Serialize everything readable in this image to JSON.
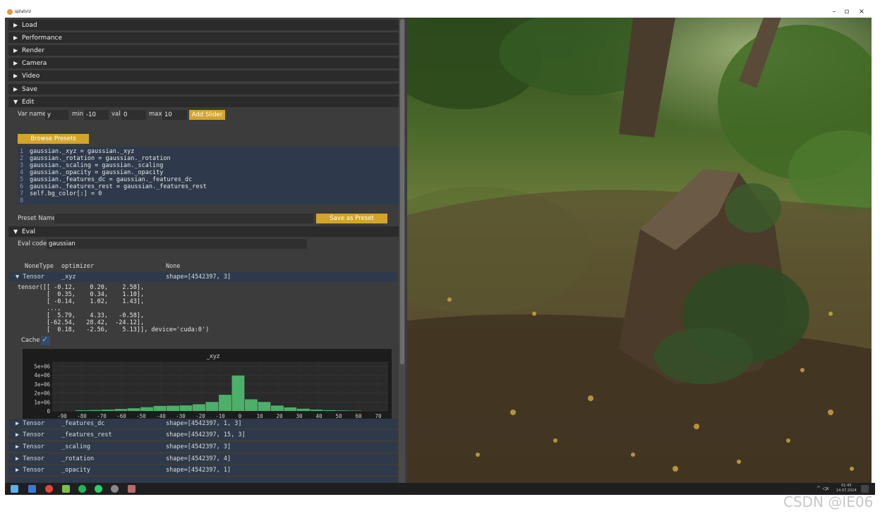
{
  "window": {
    "title": "splatviz",
    "controls": [
      "–",
      "▫",
      "×"
    ]
  },
  "sections": [
    {
      "label": "Load",
      "expanded": false
    },
    {
      "label": "Performance",
      "expanded": false
    },
    {
      "label": "Render",
      "expanded": false
    },
    {
      "label": "Camera",
      "expanded": false
    },
    {
      "label": "Video",
      "expanded": false
    },
    {
      "label": "Save",
      "expanded": false
    },
    {
      "label": "Edit",
      "expanded": true
    }
  ],
  "edit": {
    "var_name_label": "Var name",
    "var_name_value": "y",
    "min_label": "min",
    "min_value": "-10",
    "val_label": "val",
    "val_value": "0",
    "max_label": "max",
    "max_value": "10",
    "add_slider_label": "Add Slider",
    "browse_presets_label": "Browse Presets",
    "code_lines": [
      {
        "n": "1",
        "text": "gaussian._xyz = gaussian._xyz"
      },
      {
        "n": "2",
        "text": "gaussian._rotation = gaussian._rotation"
      },
      {
        "n": "3",
        "text": "gaussian._scaling = gaussian._scaling"
      },
      {
        "n": "4",
        "text": "gaussian._opacity = gaussian._opacity"
      },
      {
        "n": "5",
        "text": "gaussian._features_dc = gaussian._features_dc"
      },
      {
        "n": "6",
        "text": "gaussian._features_rest = gaussian._features_rest"
      },
      {
        "n": "7",
        "text": "self.bg_color[:] = 0"
      },
      {
        "n": "8",
        "text": ""
      }
    ],
    "preset_name_label": "Preset Name",
    "preset_name_value": "",
    "save_preset_label": "Save as Preset"
  },
  "eval": {
    "section_label": "Eval",
    "eval_code_label": "Eval code:",
    "eval_code_value": "gaussian",
    "header_row": {
      "c1": "NoneType",
      "c2": "optimizer",
      "c3": "None"
    },
    "expanded_row": {
      "tri": "▼",
      "c1": "Tensor",
      "c2": "_xyz",
      "c3": "shape=[4542397, 3]"
    },
    "tensor_text": "tensor([[ -0.12,    0.20,    2.58],\n        [  0.35,    0.34,    1.10],\n        [ -0.14,    1.02,    1.43],\n        ...,\n        [  5.79,    4.33,   -0.58],\n        [-62.54,   28.42,  -24.12],\n        [  0.18,   -2.56,    5.13]], device='cuda:0')",
    "cache_label": "Cache",
    "cache_checked": true,
    "rows": [
      {
        "tri": "▶",
        "c1": "Tensor",
        "c2": "_features_dc",
        "c3": "shape=[4542397, 1, 3]"
      },
      {
        "tri": "▶",
        "c1": "Tensor",
        "c2": "_features_rest",
        "c3": "shape=[4542397, 15, 3]"
      },
      {
        "tri": "▶",
        "c1": "Tensor",
        "c2": "_scaling",
        "c3": "shape=[4542397, 3]"
      },
      {
        "tri": "▶",
        "c1": "Tensor",
        "c2": "_rotation",
        "c3": "shape=[4542397, 4]"
      },
      {
        "tri": "▶",
        "c1": "Tensor",
        "c2": "_opacity",
        "c3": "shape=[4542397, 1]"
      }
    ]
  },
  "chart_data": {
    "type": "bar",
    "title": "_xyz",
    "bar_color": "#4caf6a",
    "x_ticks": [
      "-90",
      "-80",
      "-70",
      "-60",
      "-50",
      "-40",
      "-30",
      "-20",
      "-10",
      "0",
      "10",
      "20",
      "30",
      "40",
      "50",
      "60",
      "70"
    ],
    "y_ticks": [
      "0",
      "1e+06",
      "2e+06",
      "3e+06",
      "4e+06",
      "5e+06"
    ],
    "ylim": [
      0,
      5500000
    ],
    "xlim": [
      -95,
      75
    ],
    "bin_width": 6.6,
    "bins": [
      {
        "x": -80,
        "y": 80000
      },
      {
        "x": -73.4,
        "y": 100000
      },
      {
        "x": -66.8,
        "y": 150000
      },
      {
        "x": -60.2,
        "y": 220000
      },
      {
        "x": -53.6,
        "y": 300000
      },
      {
        "x": -47,
        "y": 420000
      },
      {
        "x": -40.4,
        "y": 560000
      },
      {
        "x": -33.8,
        "y": 580000
      },
      {
        "x": -27.2,
        "y": 620000
      },
      {
        "x": -20.6,
        "y": 750000
      },
      {
        "x": -14,
        "y": 1000000
      },
      {
        "x": -7.4,
        "y": 1800000
      },
      {
        "x": -0.8,
        "y": 3950000
      },
      {
        "x": 5.8,
        "y": 1300000
      },
      {
        "x": 12.4,
        "y": 1000000
      },
      {
        "x": 19,
        "y": 600000
      },
      {
        "x": 25.6,
        "y": 400000
      },
      {
        "x": 32.2,
        "y": 250000
      },
      {
        "x": 38.8,
        "y": 150000
      },
      {
        "x": 45.4,
        "y": 90000
      },
      {
        "x": 52,
        "y": 60000
      },
      {
        "x": 58.6,
        "y": 40000
      }
    ]
  },
  "taskbar": {
    "time": "01:45",
    "date": "14.07.2024",
    "tray": "^ ◁x"
  },
  "watermark": "CSDN @IE06"
}
